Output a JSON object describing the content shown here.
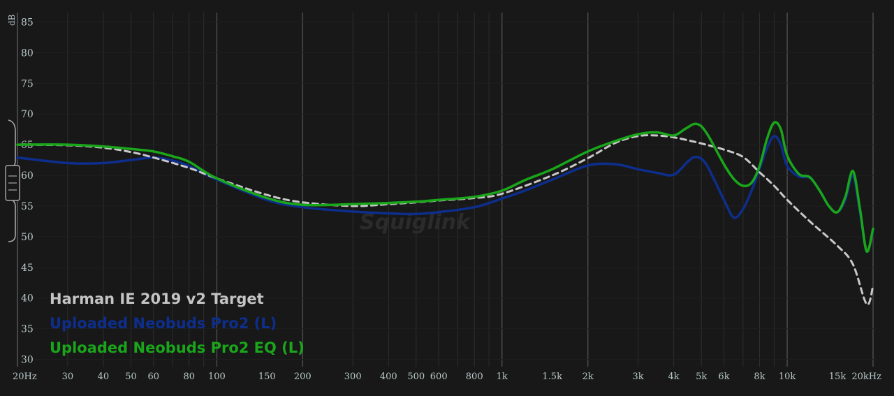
{
  "chart_data": {
    "type": "line",
    "title": "",
    "xlabel": "",
    "ylabel": "dB",
    "x_scale": "log",
    "xlim": [
      20,
      20000
    ],
    "ylim": [
      30,
      85
    ],
    "grid": true,
    "legend_position": "bottom-left",
    "watermark": "Squiglink",
    "y_ticks": [
      85,
      80,
      75,
      70,
      65,
      60,
      55,
      50,
      45,
      40,
      35,
      30
    ],
    "x_ticks": [
      {
        "value": 20,
        "label": "20Hz"
      },
      {
        "value": 30,
        "label": "30"
      },
      {
        "value": 40,
        "label": "40"
      },
      {
        "value": 50,
        "label": "50"
      },
      {
        "value": 60,
        "label": "60"
      },
      {
        "value": 80,
        "label": "80"
      },
      {
        "value": 100,
        "label": "100"
      },
      {
        "value": 150,
        "label": "150"
      },
      {
        "value": 200,
        "label": "200"
      },
      {
        "value": 300,
        "label": "300"
      },
      {
        "value": 400,
        "label": "400"
      },
      {
        "value": 500,
        "label": "500"
      },
      {
        "value": 600,
        "label": "600"
      },
      {
        "value": 800,
        "label": "800"
      },
      {
        "value": 1000,
        "label": "1k"
      },
      {
        "value": 1500,
        "label": "1.5k"
      },
      {
        "value": 2000,
        "label": "2k"
      },
      {
        "value": 3000,
        "label": "3k"
      },
      {
        "value": 4000,
        "label": "4k"
      },
      {
        "value": 5000,
        "label": "5k"
      },
      {
        "value": 6000,
        "label": "6k"
      },
      {
        "value": 8000,
        "label": "8k"
      },
      {
        "value": 10000,
        "label": "10k"
      },
      {
        "value": 15000,
        "label": "15k"
      },
      {
        "value": 20000,
        "label": "20kHz"
      }
    ],
    "series": [
      {
        "name": "Harman IE 2019 v2 Target",
        "color": "#c8c8c8",
        "dashed": true,
        "x": [
          20,
          30,
          40,
          50,
          60,
          80,
          100,
          150,
          200,
          300,
          400,
          500,
          600,
          800,
          1000,
          1500,
          2000,
          2500,
          3000,
          3500,
          4000,
          4500,
          5000,
          6000,
          7000,
          8000,
          9000,
          10000,
          12000,
          15000,
          17000,
          19000,
          20000
        ],
        "values": [
          65.0,
          64.9,
          64.5,
          63.8,
          62.9,
          61.2,
          59.5,
          56.8,
          55.6,
          55.0,
          55.3,
          55.6,
          55.9,
          56.3,
          57.0,
          60.0,
          62.8,
          65.3,
          66.4,
          66.5,
          66.2,
          65.7,
          65.2,
          64.2,
          63.0,
          60.5,
          58.3,
          56.0,
          52.5,
          48.5,
          45.5,
          39.0,
          42.0
        ]
      },
      {
        "name": "Uploaded Neobuds Pro2 (L)",
        "color": "#0d2e8c",
        "dashed": false,
        "x": [
          20,
          30,
          40,
          50,
          60,
          70,
          80,
          100,
          150,
          200,
          300,
          400,
          500,
          600,
          800,
          1000,
          1200,
          1500,
          2000,
          2500,
          3000,
          3500,
          4000,
          4500,
          4800,
          5200,
          6000,
          6500,
          7000,
          7500,
          8000,
          8500,
          9000,
          9500,
          10000,
          11000,
          12000,
          13000,
          14000,
          15000,
          16000,
          17000,
          18000,
          19000,
          20000
        ],
        "values": [
          62.9,
          62.0,
          62.0,
          62.5,
          62.9,
          62.4,
          61.5,
          59.3,
          56.0,
          54.8,
          54.1,
          53.8,
          53.7,
          54.0,
          54.8,
          56.2,
          57.5,
          59.3,
          61.6,
          61.8,
          61.0,
          60.4,
          60.1,
          62.3,
          63.0,
          61.8,
          56.0,
          53.1,
          54.5,
          57.5,
          61.0,
          64.5,
          66.4,
          65.0,
          61.5,
          59.8,
          59.6,
          57.5,
          55.0,
          54.0,
          56.0,
          60.0,
          54.0,
          47.6,
          51.0
        ]
      },
      {
        "name": "Uploaded Neobuds Pro2 EQ (L)",
        "color": "#1aa61a",
        "dashed": false,
        "x": [
          20,
          30,
          40,
          50,
          60,
          70,
          80,
          100,
          150,
          200,
          300,
          400,
          500,
          600,
          800,
          1000,
          1200,
          1500,
          2000,
          2500,
          3000,
          3500,
          4000,
          4400,
          4800,
          5200,
          6000,
          6500,
          7000,
          7500,
          8000,
          8500,
          9000,
          9500,
          10000,
          11000,
          12000,
          13000,
          14000,
          15000,
          16000,
          17000,
          18000,
          19000,
          20000
        ],
        "values": [
          65.0,
          65.0,
          64.7,
          64.3,
          63.9,
          63.1,
          62.2,
          59.5,
          56.3,
          55.2,
          55.3,
          55.5,
          55.7,
          56.0,
          56.5,
          57.5,
          59.2,
          61.0,
          63.9,
          65.6,
          66.7,
          67.0,
          66.5,
          67.6,
          68.4,
          67.0,
          61.8,
          59.4,
          58.3,
          58.8,
          61.5,
          66.0,
          68.6,
          67.5,
          63.2,
          60.2,
          59.7,
          57.5,
          55.0,
          54.0,
          56.5,
          60.7,
          54.5,
          47.6,
          51.3
        ]
      }
    ]
  }
}
